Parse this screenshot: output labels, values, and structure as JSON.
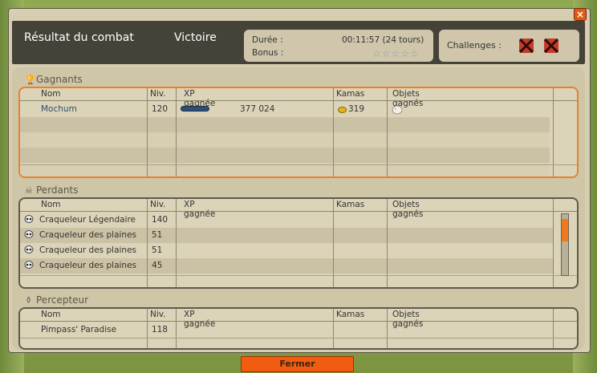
{
  "header": {
    "title": "Résultat du combat",
    "result": "Victoire",
    "duration_label": "Durée :",
    "duration_value": "00:11:57 (24 tours)",
    "bonus_label": "Bonus :",
    "challenges_label": "Challenges :"
  },
  "columns": {
    "name": "Nom",
    "level": "Niv.",
    "xp": "XP gagnée",
    "kamas": "Kamas",
    "items": "Objets gagnés"
  },
  "winners": {
    "title": "Gagnants",
    "rows": [
      {
        "name": "Mochum",
        "level": "120",
        "xp": "377 024",
        "xp_fill": 1.0,
        "kamas": "319",
        "item_icon": "loot-item-icon"
      }
    ]
  },
  "losers": {
    "title": "Perdants",
    "rows": [
      {
        "name": "Craqueleur Légendaire",
        "level": "140"
      },
      {
        "name": "Craqueleur des plaines",
        "level": "51"
      },
      {
        "name": "Craqueleur des plaines",
        "level": "51"
      },
      {
        "name": "Craqueleur des plaines",
        "level": "45"
      }
    ]
  },
  "collector": {
    "title": "Percepteur",
    "rows": [
      {
        "name": "Pimpass' Paradise",
        "level": "118"
      }
    ]
  },
  "footer": {
    "close_label": "Fermer"
  },
  "colors": {
    "accent": "#f25c10",
    "winner_border": "#e8812c",
    "header_bg": "#454238"
  }
}
